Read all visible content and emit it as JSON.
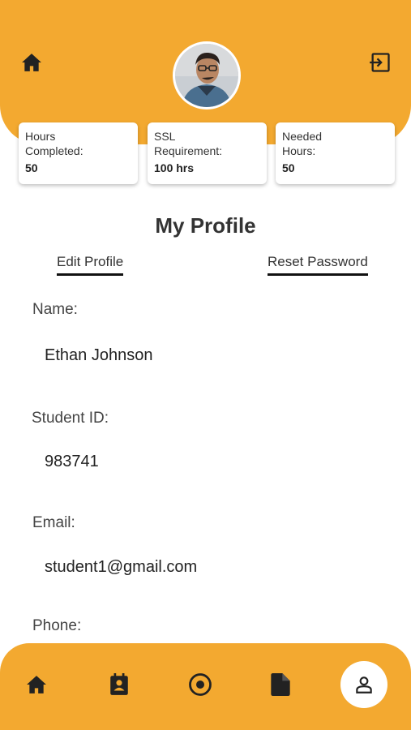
{
  "header": {
    "home_icon": "home-icon",
    "logout_icon": "logout-icon",
    "avatar": "profile-photo"
  },
  "stats": [
    {
      "label_line1": "Hours",
      "label_line2": "Completed:",
      "value": "50"
    },
    {
      "label_line1": "SSL",
      "label_line2": "Requirement:",
      "value": "100 hrs"
    },
    {
      "label_line1": "Needed",
      "label_line2": "Hours:",
      "value": "50"
    }
  ],
  "page": {
    "title": "My Profile",
    "edit_profile": "Edit Profile",
    "reset_password": "Reset Password"
  },
  "fields": {
    "name_label": "Name:",
    "name_value": "Ethan Johnson",
    "student_id_label": "Student ID:",
    "student_id_value": "983741",
    "email_label": "Email:",
    "email_value": "student1@gmail.com",
    "phone_label": "Phone:"
  },
  "nav": {
    "items": [
      "home-icon",
      "calendar-contact-icon",
      "target-icon",
      "document-icon",
      "person-icon"
    ],
    "active": "person-icon"
  },
  "colors": {
    "accent": "#F3A930",
    "icon": "#222222"
  }
}
